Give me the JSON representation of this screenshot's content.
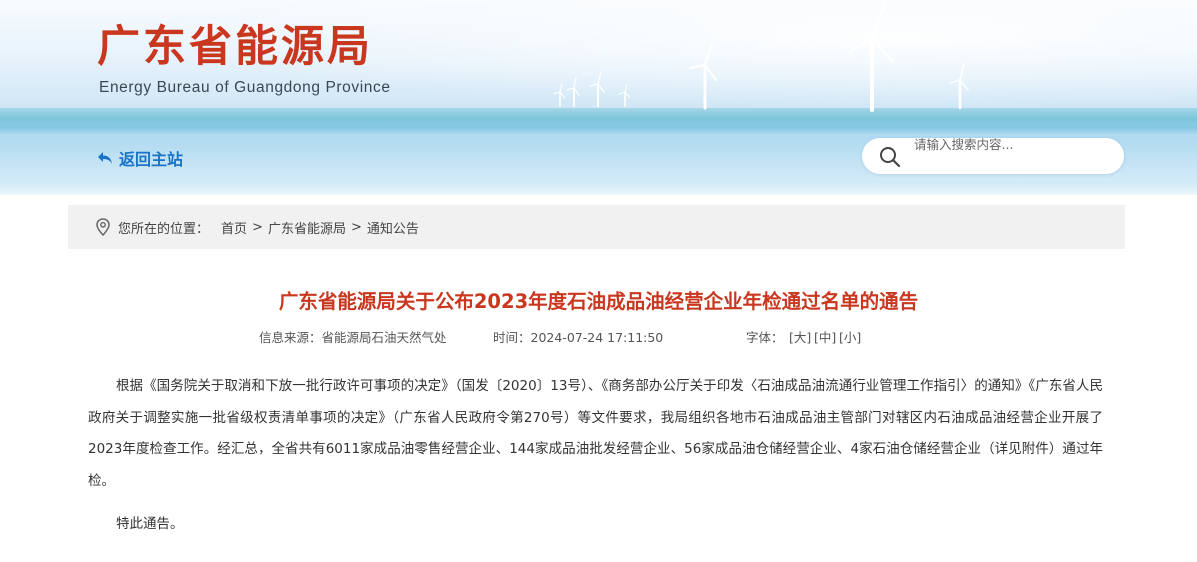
{
  "header": {
    "title": "广东省能源局",
    "subtitle": "Energy Bureau of Guangdong Province",
    "back_label": "返回主站",
    "search_placeholder": "请输入搜索内容..."
  },
  "breadcrumb": {
    "label": "您所在的位置：",
    "separator": ">",
    "items": [
      "首页",
      "广东省能源局",
      "通知公告"
    ]
  },
  "article": {
    "title": "广东省能源局关于公布2023年度石油成品油经营企业年检通过名单的通告",
    "source": "信息来源：省能源局石油天然气处",
    "time": "时间：2024-07-24 17:11:50",
    "font_label": "字体：",
    "font_large": "[大]",
    "font_medium": "[中]",
    "font_small": "[小]",
    "paragraph": "根据《国务院关于取消和下放一批行政许可事项的决定》（国发〔2020〕13号）、《商务部办公厅关于印发〈石油成品油流通行业管理工作指引〉的通知》《广东省人民政府关于调整实施一批省级权责清单事项的决定》（广东省人民政府令第270号）等文件要求，我局组织各地市石油成品油主管部门对辖区内石油成品油经营企业开展了2023年度检查工作。经汇总，全省共有6011家成品油零售经营企业、144家成品油批发经营企业、56家成品油仓储经营企业、4家石油仓储经营企业（详见附件）通过年检。",
    "closing": "特此通告。"
  },
  "colors": {
    "title_red": "#c9371f",
    "link_blue": "#1a73c6",
    "breadcrumb_bg": "#f1f1f1"
  },
  "icons": {
    "back": "back-arrow-icon",
    "search": "search-icon",
    "location": "location-pin-icon"
  }
}
